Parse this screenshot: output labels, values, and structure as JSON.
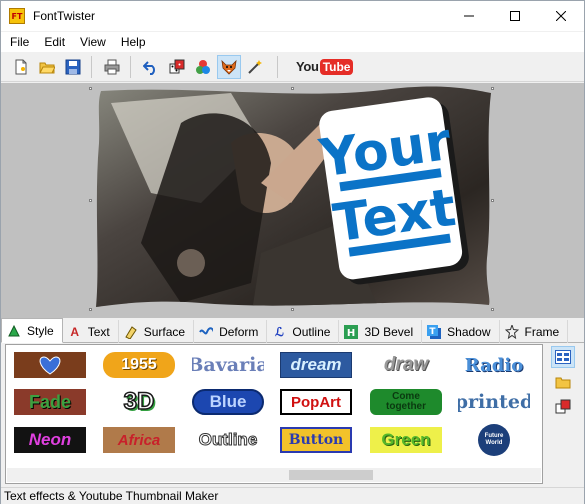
{
  "window": {
    "title": "FontTwister",
    "app_icon_text": "FT"
  },
  "menu": [
    "File",
    "Edit",
    "View",
    "Help"
  ],
  "toolbar": {
    "buttons": [
      "new-document-icon",
      "open-folder-icon",
      "save-icon",
      "print-icon",
      "undo-icon",
      "dice-icon",
      "color-circles-icon",
      "fox-icon",
      "magic-wand-icon"
    ],
    "youtube": {
      "you": "You",
      "tube": "Tube"
    }
  },
  "preview": {
    "line1": "Your",
    "line2": "Text"
  },
  "tabs": [
    {
      "label": "Style",
      "icon": "style-icon",
      "active": true
    },
    {
      "label": "Text",
      "icon": "text-icon"
    },
    {
      "label": "Surface",
      "icon": "surface-icon"
    },
    {
      "label": "Deform",
      "icon": "deform-icon"
    },
    {
      "label": "Outline",
      "icon": "outline-icon"
    },
    {
      "label": "3D Bevel",
      "icon": "bevel-icon"
    },
    {
      "label": "Shadow",
      "icon": "shadow-icon"
    },
    {
      "label": "Frame",
      "icon": "frame-icon"
    }
  ],
  "styles": [
    [
      "",
      "1955",
      "Bavaria",
      "dream",
      "draw",
      "Radio"
    ],
    [
      "Fade",
      "3D",
      "Blue",
      "PopArt",
      "Come together",
      "printed"
    ],
    [
      "Neon",
      "Africa",
      "Outline",
      "Button",
      "Green",
      "Future World"
    ]
  ],
  "side_buttons": [
    "gallery-view-icon",
    "open-folder-icon",
    "random-dice-icon"
  ],
  "status": "Text effects & Youtube Thumbnail Maker",
  "colors": {
    "accent": "#0b73c7",
    "youtube_red": "#e52d27"
  }
}
